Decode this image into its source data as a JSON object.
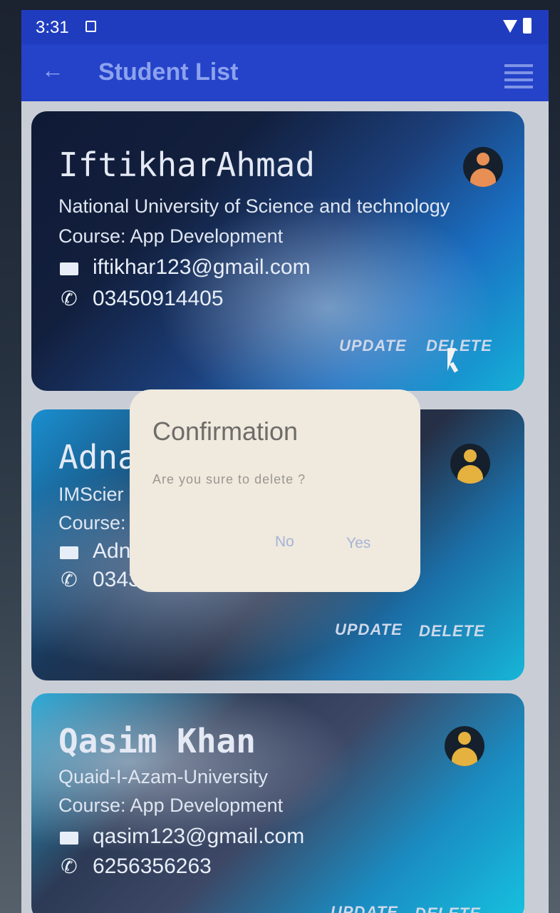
{
  "status": {
    "time": "3:31"
  },
  "appbar": {
    "title": "Student List"
  },
  "cards": [
    {
      "name": "IftikharAhmad",
      "university": "National University of Science and technology",
      "course": "Course: App Development",
      "email": "iftikhar123@gmail.com",
      "phone": "03450914405",
      "update": "UPDATE",
      "delete": "DELETE"
    },
    {
      "name": "Adna",
      "university": "IMScier",
      "course": "Course:",
      "email": "Adn",
      "phone": "0343",
      "update": "UPDATE",
      "delete": "DELETE"
    },
    {
      "name": "Qasim Khan",
      "university": "Quaid-I-Azam-University",
      "course": "Course: App Development",
      "email": "qasim123@gmail.com",
      "phone": "6256356263",
      "update": "UPDATE",
      "delete": "DELETE"
    }
  ],
  "dialog": {
    "title": "Confirmation",
    "message": "Are you sure to delete ?",
    "no": "No",
    "yes": "Yes"
  },
  "icons": {
    "back": "arrow-left-icon",
    "menu": "list-menu-icon",
    "email": "email-icon",
    "phone": "phone-icon",
    "avatar": "person-avatar-icon"
  },
  "colors": {
    "appbar": "#2443c9",
    "dialog": "#efe9de"
  }
}
